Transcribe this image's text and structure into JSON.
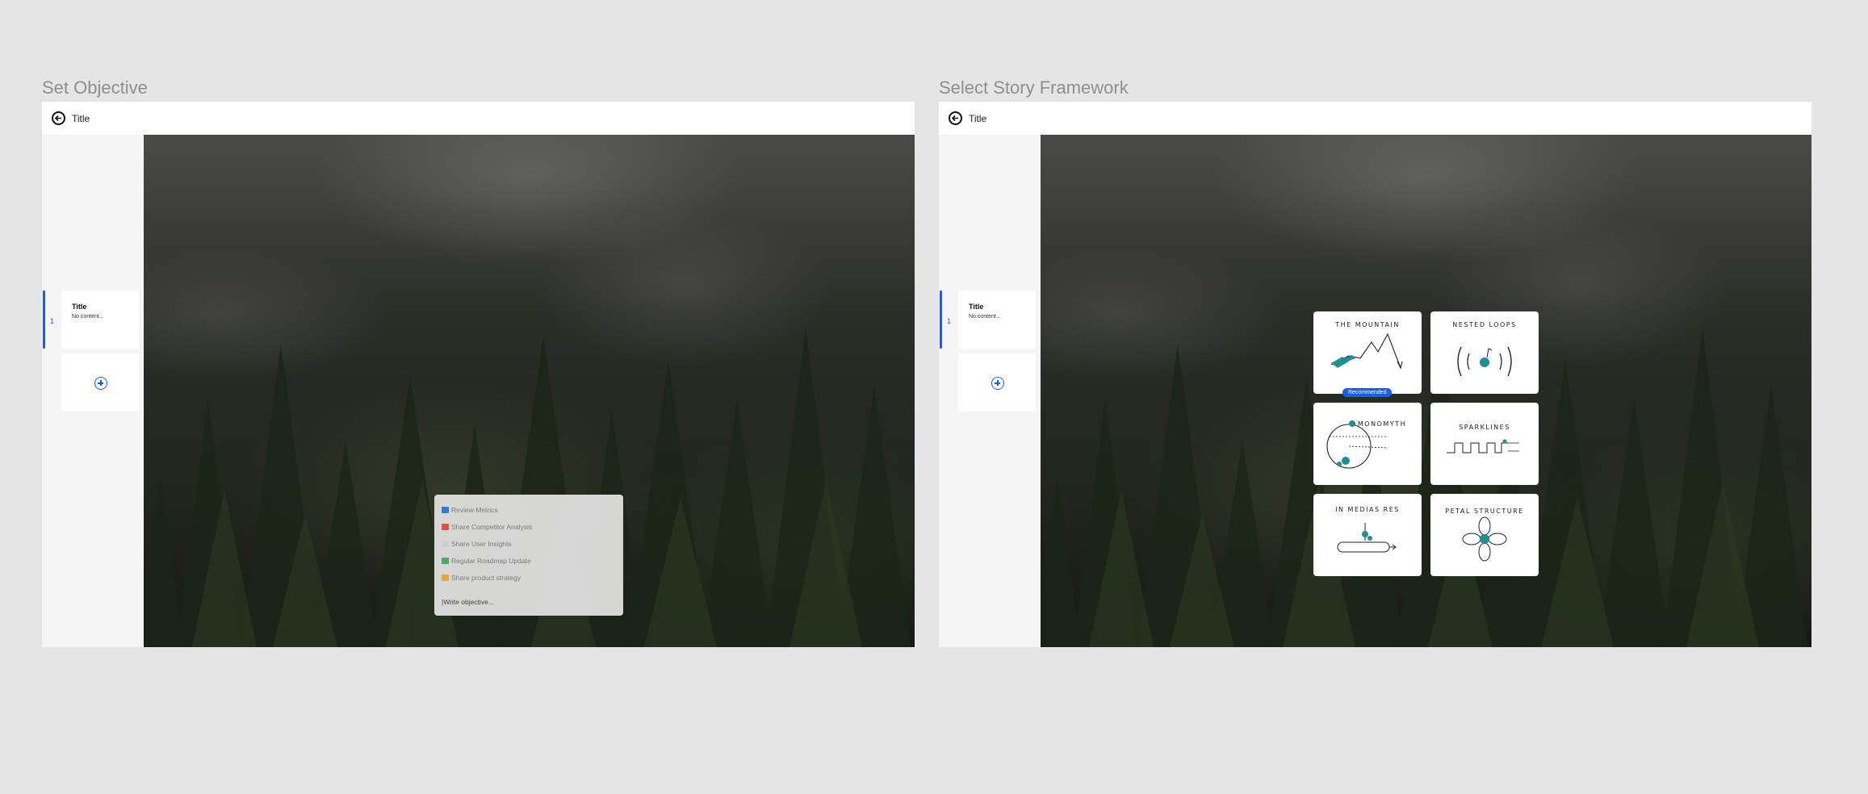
{
  "left_frame": {
    "heading": "Set Objective",
    "topbar_title": "Title",
    "slide": {
      "number": "1",
      "title": "Title",
      "subtitle": "No content..."
    },
    "objective_menu": {
      "items": [
        {
          "label": "Review Metrics",
          "icon": "bar-chart-icon",
          "color": "#3a78d4"
        },
        {
          "label": "Share Competitor Analysis",
          "icon": "calendar-icon",
          "color": "#e0523a"
        },
        {
          "label": "Share User Insights",
          "icon": "speech-bubble-icon",
          "color": "#b8b8b8"
        },
        {
          "label": "Regular Roadmap Update",
          "icon": "map-icon",
          "color": "#4fa86a"
        },
        {
          "label": "Share product strategy",
          "icon": "folder-icon",
          "color": "#e8a93a"
        }
      ],
      "write_placeholder": "|Write objective..."
    }
  },
  "right_frame": {
    "heading": "Select Story Framework",
    "topbar_title": "Title",
    "slide": {
      "number": "1",
      "title": "Title",
      "subtitle": "No content..."
    },
    "frameworks": [
      {
        "label": "THE MOUNTAIN",
        "recommended": true,
        "badge": "Recommended"
      },
      {
        "label": "NESTED LOOPS",
        "recommended": false
      },
      {
        "label": "MONOMYTH",
        "recommended": false
      },
      {
        "label": "SPARKLINES",
        "recommended": false
      },
      {
        "label": "IN MEDIAS RES",
        "recommended": false
      },
      {
        "label": "PETAL STRUCTURE",
        "recommended": false
      }
    ]
  },
  "colors": {
    "accent": "#1a5cf0",
    "teal": "#1f8f93",
    "background": "#e5e5e5"
  }
}
